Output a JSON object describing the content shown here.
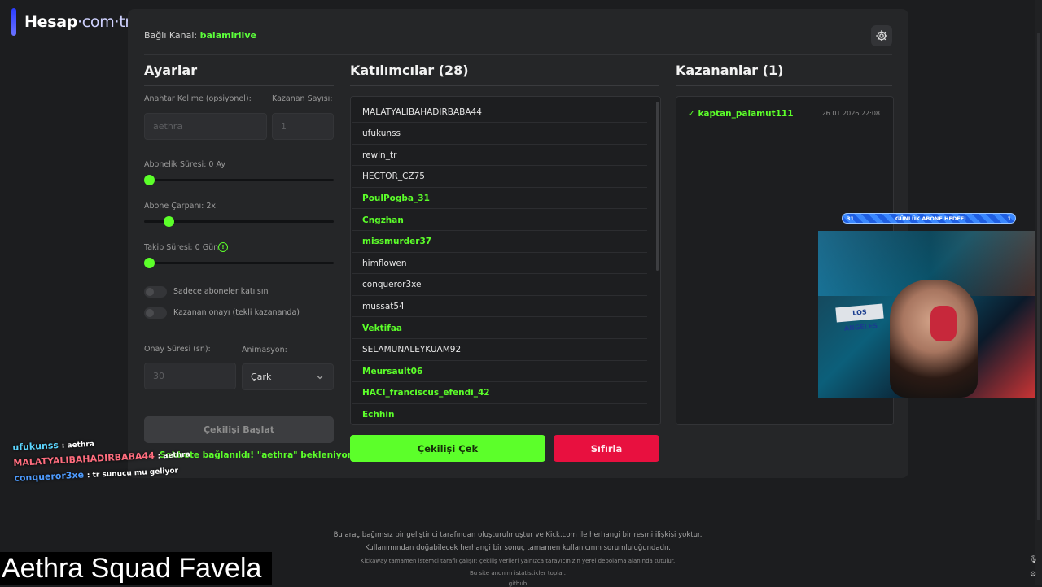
{
  "logo": {
    "brand": "Hesap",
    "rest": "·com·tr"
  },
  "channel": {
    "label": "Bağlı Kanal:",
    "name": "balamirlive"
  },
  "settings": {
    "title": "Ayarlar",
    "keyword_label": "Anahtar Kelime (opsiyonel):",
    "keyword_placeholder": "aethra",
    "winner_count_label": "Kazanan Sayısı:",
    "winner_count_placeholder": "1",
    "sub_duration_label": "Abonelik Süresi: 0 Ay",
    "sub_duration_value": 0,
    "sub_multiplier_label": "Abone Çarpanı: 2x",
    "sub_multiplier_value": 2,
    "follow_duration_label": "Takip Süresi: 0 Gün",
    "follow_duration_value": 0,
    "info_glyph": "!",
    "toggle_subs_only": "Sadece aboneler katılsın",
    "toggle_winner_confirm": "Kazanan onayı (tekli kazananda)",
    "confirm_time_label": "Onay Süresi (sn):",
    "confirm_time_placeholder": "30",
    "animation_label": "Animasyon:",
    "animation_value": "Çark",
    "start_button": "Çekilişi Başlat",
    "status": "Sohbete bağlanıldı! \"aethra\" bekleniyor."
  },
  "participants": {
    "title": "Katılımcılar (28)",
    "rows": [
      {
        "name": "MALATYALIBAHADIRBABA44",
        "sub": false
      },
      {
        "name": "ufukunss",
        "sub": false
      },
      {
        "name": "rewln_tr",
        "sub": false
      },
      {
        "name": "HECTOR_CZ75",
        "sub": false
      },
      {
        "name": "PoulPogba_31",
        "sub": true
      },
      {
        "name": "Cngzhan",
        "sub": true
      },
      {
        "name": "missmurder37",
        "sub": true
      },
      {
        "name": "himflowen",
        "sub": false
      },
      {
        "name": "conqueror3xe",
        "sub": false
      },
      {
        "name": "mussat54",
        "sub": false
      },
      {
        "name": "Vektifaa",
        "sub": true
      },
      {
        "name": "SELAMUNALEYKUAM92",
        "sub": false
      },
      {
        "name": "Meursault06",
        "sub": true
      },
      {
        "name": "HACI_franciscus_efendi_42",
        "sub": true
      },
      {
        "name": "Echhin",
        "sub": true
      }
    ],
    "draw_button": "Çekilişi Çek",
    "reset_button": "Sıfırla"
  },
  "winners": {
    "title": "Kazananlar (1)",
    "rows": [
      {
        "name": "✓ kaptan_palamut111",
        "date": "26.01.2026 22:08"
      }
    ]
  },
  "chat_overlay": [
    {
      "user": "ufukunss",
      "msg": ": aethra"
    },
    {
      "user": "MALATYALIBAHADIRBABA44",
      "msg": ": aethra"
    },
    {
      "user": "conqueror3xe",
      "msg": ": tr sunucu mu geliyor"
    }
  ],
  "footer": {
    "line1": "Bu araç bağımsız bir geliştirici tarafından oluşturulmuştur ve Kick.com ile herhangi bir resmi ilişkisi yoktur.",
    "line2": "Kullanımından doğabilecek herhangi bir sonuç tamamen kullanıcının sorumluluğundadır.",
    "line3": "Kickaway tamamen istemci taraflı çalışır; çekiliş verileri yalnızca tarayıcınızın yerel depolama alanında tutulur.",
    "line4": "Bu site anonim istatistikler toplar.",
    "line5": "github"
  },
  "stream_caption": "Aethra Squad Favela",
  "goal_bar": {
    "left": "31",
    "label": "GÜNLÜK ABONE HEDEFİ",
    "right": "1"
  },
  "webcam_sign": "LOS ANGELES",
  "colors": {
    "accent_green": "#5cff2a",
    "danger_red": "#e8103f",
    "card_bg": "#252628"
  },
  "icons": {
    "settings": "gear-icon",
    "select": "chevron-down-icon",
    "info": "info-icon"
  }
}
